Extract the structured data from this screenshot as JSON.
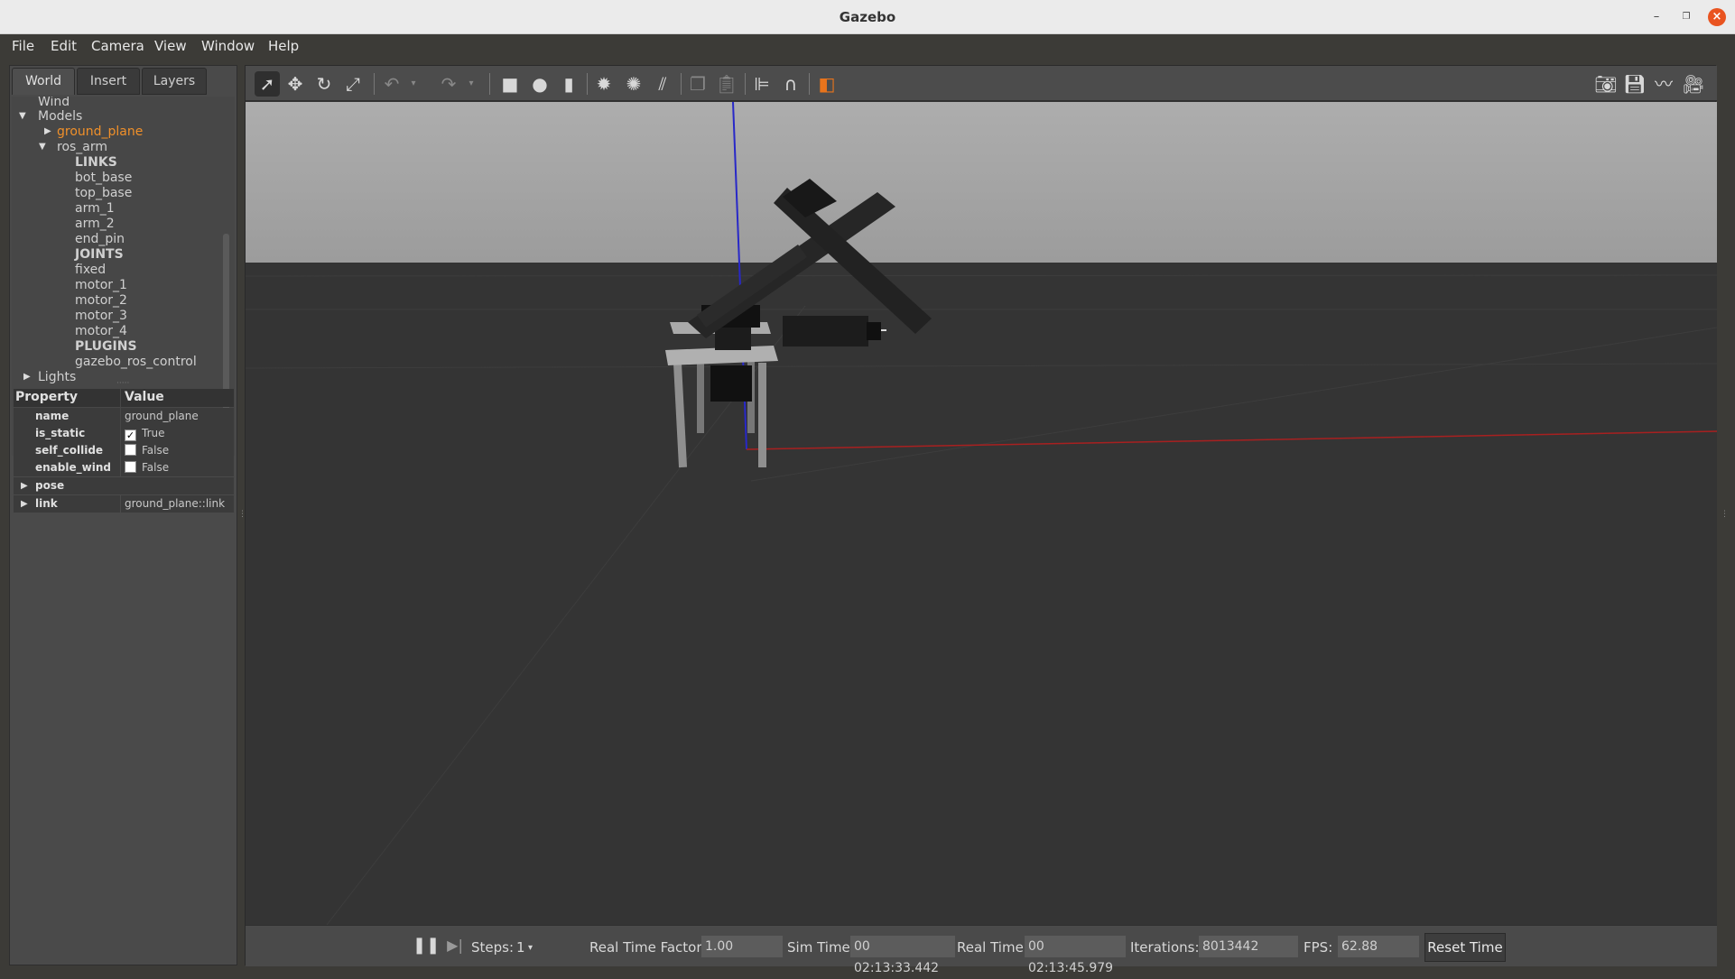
{
  "window": {
    "title": "Gazebo"
  },
  "menu": [
    "File",
    "Edit",
    "Camera",
    "View",
    "Window",
    "Help"
  ],
  "tabs": [
    "World",
    "Insert",
    "Layers"
  ],
  "tree": {
    "wind": "Wind",
    "models": "Models",
    "ground_plane": "ground_plane",
    "ros_arm": "ros_arm",
    "links_header": "LINKS",
    "links": [
      "bot_base",
      "top_base",
      "arm_1",
      "arm_2",
      "end_pin"
    ],
    "joints_header": "JOINTS",
    "joints": [
      "fixed",
      "motor_1",
      "motor_2",
      "motor_3",
      "motor_4"
    ],
    "plugins_header": "PLUGINS",
    "plugins": [
      "gazebo_ros_control"
    ],
    "lights": "Lights"
  },
  "properties": {
    "header_property": "Property",
    "header_value": "Value",
    "name_label": "name",
    "name_value": "ground_plane",
    "is_static_label": "is_static",
    "is_static_value": "True",
    "is_static_checked": true,
    "self_collide_label": "self_collide",
    "self_collide_value": "False",
    "enable_wind_label": "enable_wind",
    "enable_wind_value": "False",
    "pose_label": "pose",
    "link_label": "link",
    "link_value": "ground_plane::link"
  },
  "toolbar": {
    "icons": [
      "select-mode-icon",
      "translate-icon",
      "rotate-icon",
      "scale-icon",
      "undo-icon",
      "redo-icon",
      "box-icon",
      "sphere-icon",
      "cylinder-icon",
      "point-light-icon",
      "spot-light-icon",
      "directional-light-icon",
      "copy-icon",
      "paste-icon",
      "align-icon",
      "snap-icon",
      "view-angle-icon",
      "screenshot-icon",
      "log-icon",
      "plot-icon",
      "record-video-icon"
    ]
  },
  "status": {
    "steps_label": "Steps:",
    "steps_value": "1",
    "rtf_label": "Real Time Factor:",
    "rtf_value": "1.00",
    "sim_time_label": "Sim Time:",
    "sim_time_value": "00 02:13:33.442",
    "real_time_label": "Real Time:",
    "real_time_value": "00 02:13:45.979",
    "iterations_label": "Iterations:",
    "iterations_value": "8013442",
    "fps_label": "FPS:",
    "fps_value": "62.88",
    "reset_label": "Reset Time"
  },
  "colors": {
    "accent_selected": "#f0902a",
    "close_button": "#e95420",
    "z_axis": "#2020d0",
    "x_axis": "#b02020"
  }
}
